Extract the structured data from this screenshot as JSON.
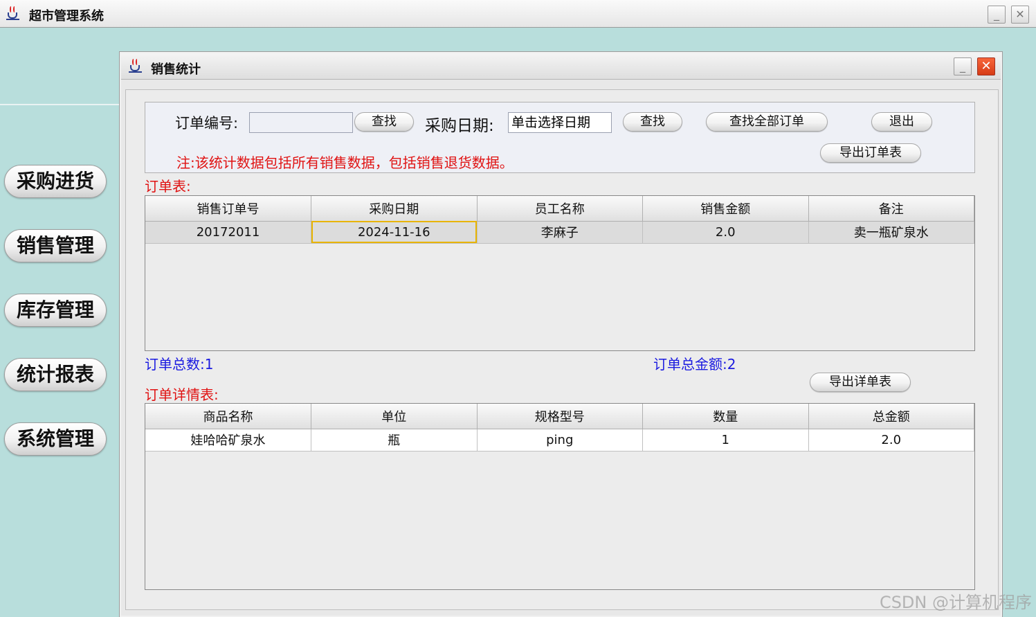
{
  "outer_window": {
    "title": "超市管理系统"
  },
  "sidebar": {
    "items": [
      {
        "label": "采购进货"
      },
      {
        "label": "销售管理"
      },
      {
        "label": "库存管理"
      },
      {
        "label": "统计报表"
      },
      {
        "label": "系统管理"
      }
    ]
  },
  "inner_window": {
    "title": "销售统计"
  },
  "search": {
    "order_no_label": "订单编号:",
    "order_no_value": "",
    "find_button": "查找",
    "date_label": "采购日期:",
    "date_value": "单击选择日期",
    "find_date_button": "查找",
    "find_all_button": "查找全部订单",
    "exit_button": "退出",
    "export_orders_button": "导出订单表",
    "note": "注:该统计数据包括所有销售数据，包括销售退货数据。"
  },
  "orders": {
    "section_label": "订单表:",
    "columns": [
      "销售订单号",
      "采购日期",
      "员工名称",
      "销售金额",
      "备注"
    ],
    "rows": [
      [
        "20172011",
        "2024-11-16",
        "李麻子",
        "2.0",
        "卖一瓶矿泉水"
      ]
    ],
    "total_count_label": "订单总数:1",
    "total_amount_label": "订单总金额:2"
  },
  "details": {
    "section_label": "订单详情表:",
    "export_button": "导出详单表",
    "columns": [
      "商品名称",
      "单位",
      "规格型号",
      "数量",
      "总金额"
    ],
    "rows": [
      [
        "娃哈哈矿泉水",
        "瓶",
        "ping",
        "1",
        "2.0"
      ]
    ]
  },
  "watermark": "CSDN @计算机程序"
}
